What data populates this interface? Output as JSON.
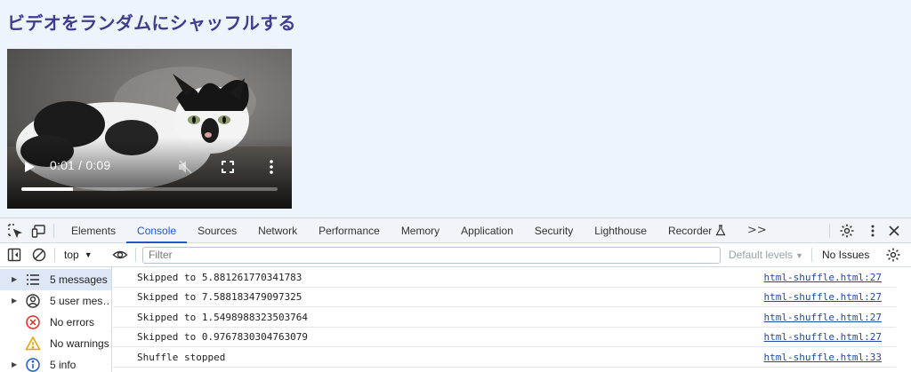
{
  "page": {
    "title": "ビデオをランダムにシャッフルする"
  },
  "video": {
    "time": "0:01 / 0:09",
    "progress_fraction": 0.2
  },
  "devtools": {
    "tabs": [
      {
        "label": "Elements"
      },
      {
        "label": "Console"
      },
      {
        "label": "Sources"
      },
      {
        "label": "Network"
      },
      {
        "label": "Performance"
      },
      {
        "label": "Memory"
      },
      {
        "label": "Application"
      },
      {
        "label": "Security"
      },
      {
        "label": "Lighthouse"
      },
      {
        "label": "Recorder"
      }
    ],
    "overflow_label": ">>",
    "toolbar": {
      "context": "top",
      "filter_placeholder": "Filter",
      "levels_label": "Default levels",
      "issues_label": "No Issues"
    },
    "sidebar": [
      {
        "label": "5 messages",
        "icon": "list-icon"
      },
      {
        "label": "5 user mes…",
        "icon": "user-icon"
      },
      {
        "label": "No errors",
        "icon": "error-icon"
      },
      {
        "label": "No warnings",
        "icon": "warning-icon"
      },
      {
        "label": "5 info",
        "icon": "info-icon"
      }
    ],
    "logs": [
      {
        "message": "Skipped to 5.881261770341783",
        "source": "html-shuffle.html:27"
      },
      {
        "message": "Skipped to 7.588183479097325",
        "source": "html-shuffle.html:27"
      },
      {
        "message": "Skipped to 1.5498988323503764",
        "source": "html-shuffle.html:27"
      },
      {
        "message": "Skipped to 0.9767830304763079",
        "source": "html-shuffle.html:27"
      },
      {
        "message": "Shuffle stopped",
        "source": "html-shuffle.html:33"
      }
    ],
    "colors": {
      "accent": "#1a5bd0",
      "link": "#1f4aa8",
      "title": "#3f3d8f"
    }
  }
}
